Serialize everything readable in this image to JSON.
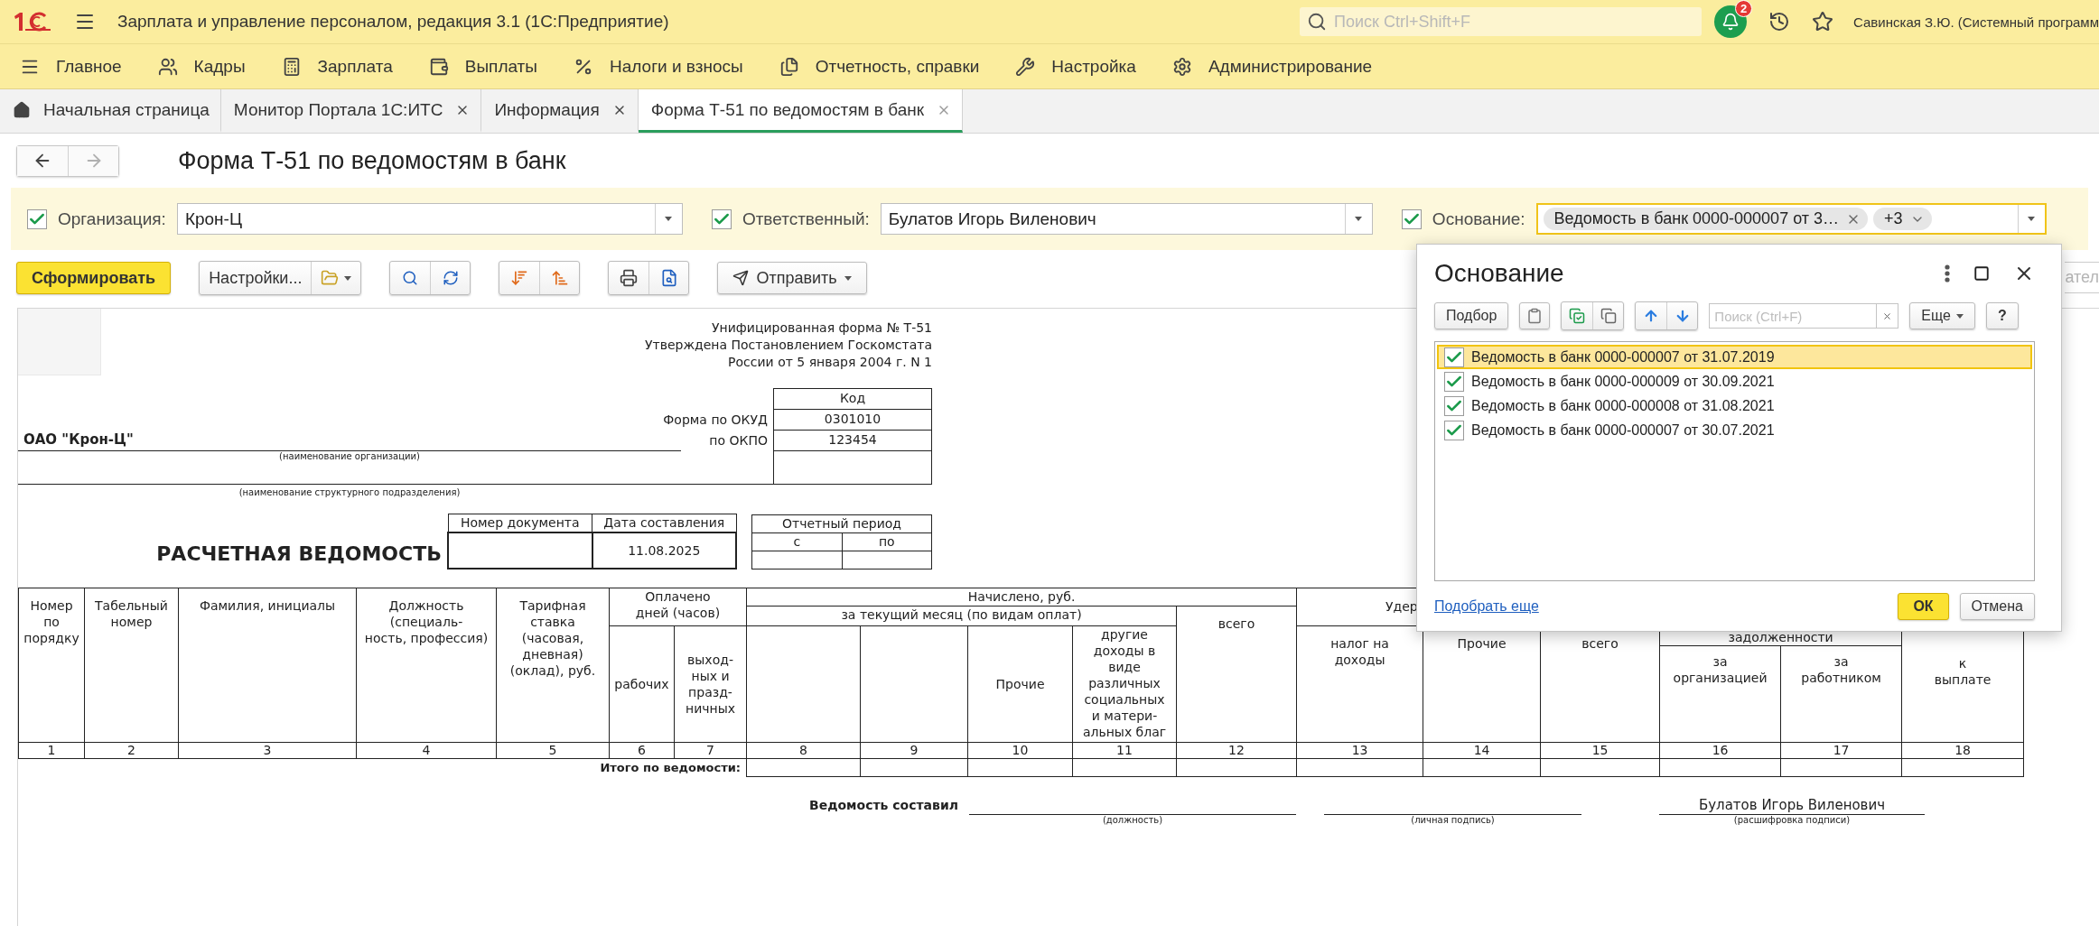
{
  "app": {
    "title": "Зарплата и управление персоналом, редакция 3.1  (1С:Предприятие)",
    "search_placeholder": "Поиск Ctrl+Shift+F",
    "notifications": "2",
    "user": "Савинская З.Ю. (Системный программ"
  },
  "menu": [
    {
      "label": "Главное"
    },
    {
      "label": "Кадры"
    },
    {
      "label": "Зарплата"
    },
    {
      "label": "Выплаты"
    },
    {
      "label": "Налоги и взносы"
    },
    {
      "label": "Отчетность, справки"
    },
    {
      "label": "Настройка"
    },
    {
      "label": "Администрирование"
    }
  ],
  "tabs": [
    {
      "kind": "home",
      "label": "Начальная страница",
      "selected": false
    },
    {
      "kind": "document",
      "label": "Монитор Портала 1С:ИТС",
      "selected": false
    },
    {
      "kind": "document",
      "label": "Информация",
      "selected": false
    },
    {
      "kind": "document",
      "label": "Форма Т-51 по ведомостям в банк",
      "selected": true
    }
  ],
  "navigation": [
    {
      "disabled": false
    },
    {
      "disabled": true
    }
  ],
  "page": {
    "title": "Форма Т-51 по ведомостям в банк"
  },
  "filters": [
    {
      "kind": "text",
      "label": "Организация:",
      "checked": true,
      "focused": false,
      "value": "Крон-Ц"
    },
    {
      "kind": "text",
      "label": "Ответственный:",
      "checked": true,
      "focused": false,
      "value": "Булатов Игорь Виленович"
    },
    {
      "kind": "chips",
      "label": "Основание:",
      "checked": true,
      "focused": true,
      "chips": [
        "Ведомость в банк 0000-000007 от 3…",
        "+3"
      ]
    }
  ],
  "toolbar": {
    "generate": "Сформировать",
    "settings": "Настройки...",
    "send": "Отправить",
    "cut_field": "ател"
  },
  "report": {
    "form_note": [
      "Унифицированная форма № Т-51",
      "Утверждена Постановлением Госкомстата",
      "России от 5 января 2004 г. N 1"
    ],
    "code_header": "Код",
    "okud_label": "Форма по ОКУД",
    "okud": "0301010",
    "okpo_label": "по ОКПО",
    "okpo": "123454",
    "organization": "ОАО \"Крон-Ц\"",
    "organization_caption": "(наименование организации)",
    "department_caption": "(наименование структурного подразделения)",
    "title": "РАСЧЕТНАЯ ВЕДОМОСТЬ",
    "doc_number_label": "Номер документа",
    "doc_date_label": "Дата составления",
    "doc_date": "11.08.2025",
    "period_label": "Отчетный период",
    "period_from": "с",
    "period_to": "по",
    "header": {
      "number": "Номер\nпо\nпорядку",
      "personnel_number": "Табельный\nномер",
      "name": "Фамилия, инициалы",
      "position": "Должность\n(специаль-\nность, профессия)",
      "rate": "Тарифная\nставка\n(часовая,\nдневная)\n(оклад), руб.",
      "paid_days": "Оплачено\nдней (часов)",
      "working": "рабочих",
      "holidays": "выход-\nных и\nпразд-\nничных",
      "accrued": "Начислено, руб.",
      "current_month": "за текущий месяц (по видам оплат)",
      "other": "Прочие",
      "other_income": "другие\nдоходы в\nвиде\nразличных\nсоциальных\nи матери-\nальных благ",
      "accrued_total": "всего",
      "withheld": "Удер",
      "income_tax": "налог на\nдоходы",
      "withheld_other": "Прочие",
      "withheld_total": "всего",
      "debt": "задолженности",
      "by_org": "за\nорганизацией",
      "by_employee": "за\nработником",
      "to_pay": "к\nвыплате"
    },
    "column_numbers": [
      "1",
      "2",
      "3",
      "4",
      "5",
      "6",
      "7",
      "8",
      "9",
      "10",
      "11",
      "12",
      "13",
      "14",
      "15",
      "16",
      "17",
      "18"
    ],
    "total_label": "Итого по ведомости:",
    "signature": {
      "label": "Ведомость составил",
      "position_caption": "(должность)",
      "signature_caption": "(личная подпись)",
      "name": "Булатов Игорь Виленович",
      "name_caption": "(расшифровка подписи)"
    }
  },
  "dialog": {
    "title": "Основание",
    "pick": "Подбор",
    "search_placeholder": "Поиск (Ctrl+F)",
    "more": "Еще",
    "help": "?",
    "items": [
      {
        "label": "Ведомость в банк 0000-000007 от 31.07.2019",
        "checked": true,
        "selected": true
      },
      {
        "label": "Ведомость в банк 0000-000009 от 30.09.2021",
        "checked": true,
        "selected": false
      },
      {
        "label": "Ведомость в банк 0000-000008 от 31.08.2021",
        "checked": true,
        "selected": false
      },
      {
        "label": "Ведомость в банк 0000-000007 от 30.07.2021",
        "checked": true,
        "selected": false
      }
    ],
    "link": "Подобрать еще",
    "ok": "ОК",
    "cancel": "Отмена"
  }
}
